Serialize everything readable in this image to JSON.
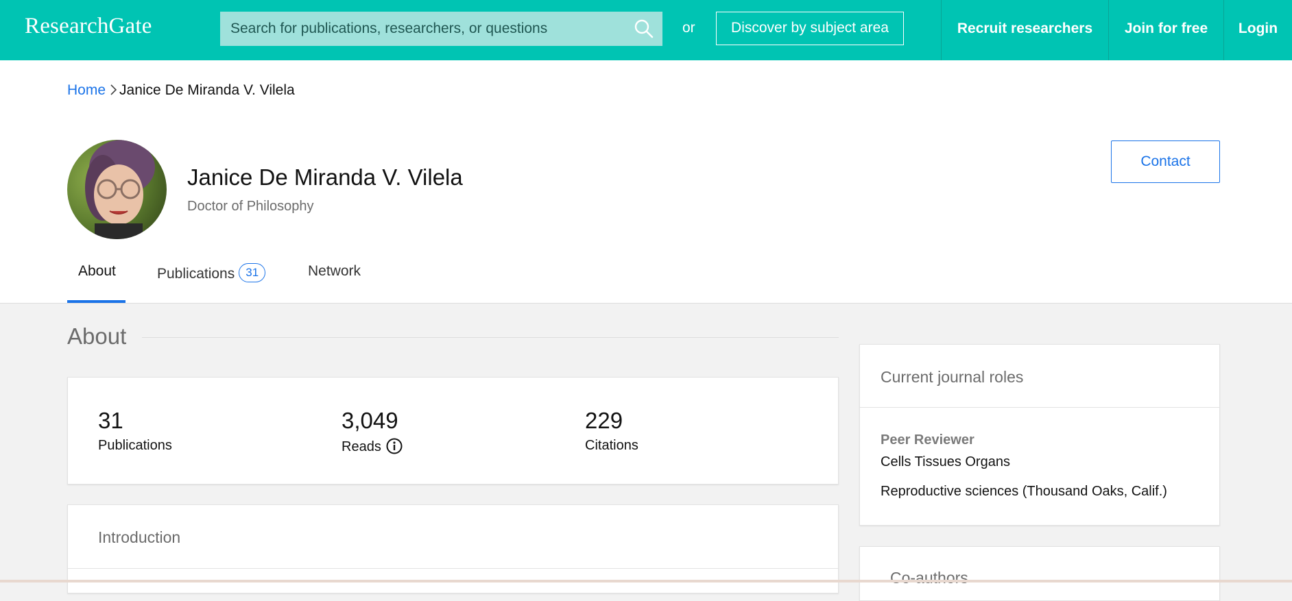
{
  "header": {
    "logo": "ResearchGate",
    "search_placeholder": "Search for publications, researchers, or questions",
    "or_text": "or",
    "discover_label": "Discover by subject area",
    "recruit_label": "Recruit researchers",
    "join_label": "Join for free",
    "login_label": "Login",
    "brand_color": "#00c4b3"
  },
  "breadcrumb": {
    "home": "Home",
    "current": "Janice De Miranda V. Vilela"
  },
  "profile": {
    "name": "Janice De Miranda V. Vilela",
    "degree": "Doctor of Philosophy",
    "contact_label": "Contact"
  },
  "tabs": [
    {
      "label": "About",
      "active": true
    },
    {
      "label": "Publications",
      "badge": "31"
    },
    {
      "label": "Network"
    }
  ],
  "about": {
    "title": "About",
    "stats": [
      {
        "value": "31",
        "label": "Publications"
      },
      {
        "value": "3,049",
        "label": "Reads",
        "icon": "info-icon"
      },
      {
        "value": "229",
        "label": "Citations"
      }
    ],
    "introduction_title": "Introduction"
  },
  "sidebar": {
    "journal_roles_title": "Current journal roles",
    "role_heading": "Peer Reviewer",
    "journals": [
      "Cells Tissues Organs",
      "Reproductive sciences (Thousand Oaks, Calif.)"
    ],
    "coauthors_title": "Co-authors"
  },
  "colors": {
    "accent_blue": "#1a73e8",
    "page_bg": "#f2f2f2"
  }
}
